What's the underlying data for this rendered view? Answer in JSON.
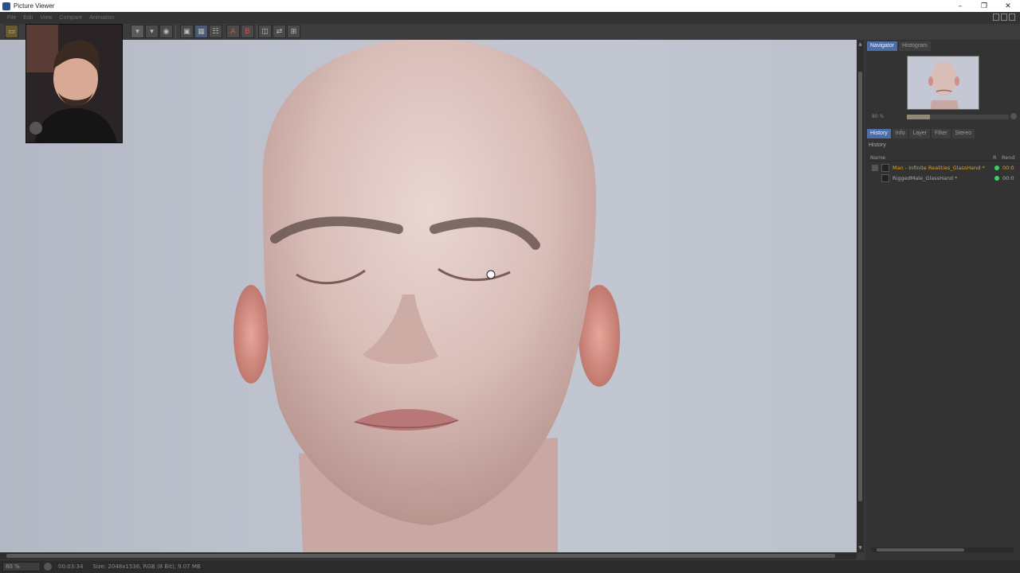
{
  "window": {
    "title": "Picture Viewer",
    "minimize": "–",
    "restore": "❐",
    "close": "✕"
  },
  "menu": [
    "File",
    "Edit",
    "View",
    "Compare",
    "Animation"
  ],
  "toolbar": {
    "icons": [
      "open-icon",
      "save-icon",
      "save-as-icon",
      "render-icon",
      "ab-compare-icon",
      "region-icon",
      "channels-icon",
      "a-icon",
      "b-icon",
      "split-icon",
      "swap-icon",
      "layout-icon"
    ],
    "a_label": "A",
    "b_label": "B"
  },
  "navigator": {
    "tabs": [
      "Navigator",
      "Histogram"
    ],
    "zoom_label": "80 %",
    "zoom_fraction": 0.23
  },
  "history_panel": {
    "tabs": [
      "History",
      "Info",
      "Layer",
      "Filter",
      "Stereo"
    ],
    "header": "History",
    "col_name": "Name",
    "col_r": "R",
    "col_ren": "Rend",
    "rows": [
      {
        "label": "Man - Infinite Realities_GlassHand *",
        "ren": "00:0",
        "selected": true
      },
      {
        "label": "RiggedMale_GlassHand *",
        "ren": "00:0",
        "selected": false
      }
    ]
  },
  "status": {
    "zoom": "80 %",
    "time": "00:03:34",
    "info": "Size: 2048x1536, RGB (8 Bit), 9.07 MB"
  },
  "colors": {
    "accent": "#4b6ea8",
    "selected_text": "#e0a02c",
    "status_green": "#35d65b"
  }
}
